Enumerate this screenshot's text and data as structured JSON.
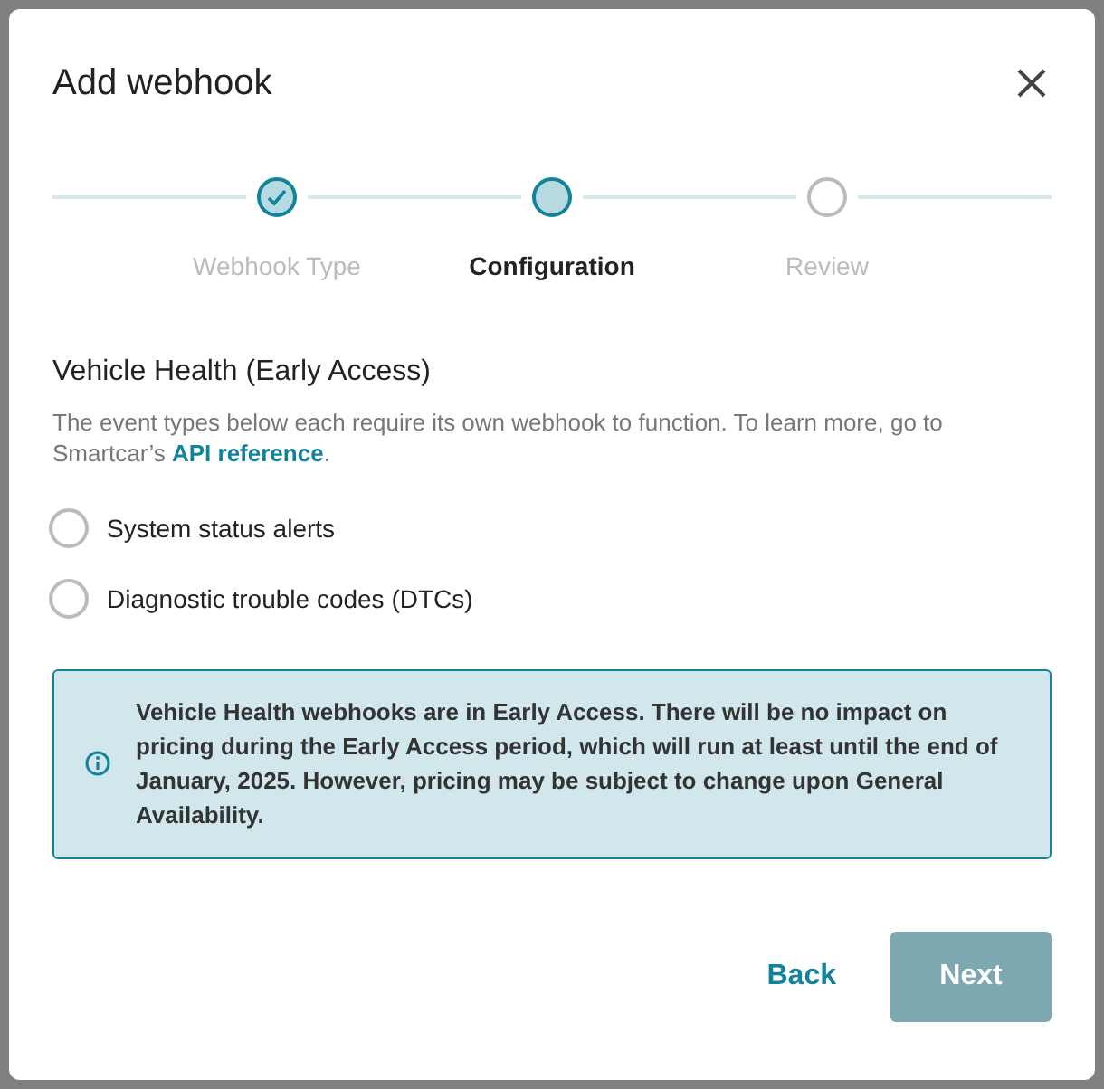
{
  "dialog": {
    "title": "Add webhook"
  },
  "steps": [
    {
      "label": "Webhook Type",
      "completed": true,
      "selected": false
    },
    {
      "label": "Configuration",
      "completed": false,
      "selected": true
    },
    {
      "label": "Review",
      "completed": false,
      "selected": false
    }
  ],
  "section": {
    "heading": "Vehicle Health (Early Access)",
    "description_before": "The event types below each require its own webhook to function. To learn more, go to Smartcar’s ",
    "link": "API reference",
    "description_after": "."
  },
  "options": [
    {
      "label": "System status alerts",
      "selected": false
    },
    {
      "label": "Diagnostic trouble codes (DTCs)",
      "selected": false
    }
  ],
  "notice": {
    "text": "Vehicle Health webhooks are in Early Access. There will be no impact on pricing during the Early Access period, which will run at least until the end of January, 2025. However, pricing may be subject to change upon General Availability."
  },
  "buttons": [
    {
      "label": "Back",
      "kind": "link"
    },
    {
      "label": "Next",
      "kind": "primary",
      "disabled": true
    }
  ]
}
